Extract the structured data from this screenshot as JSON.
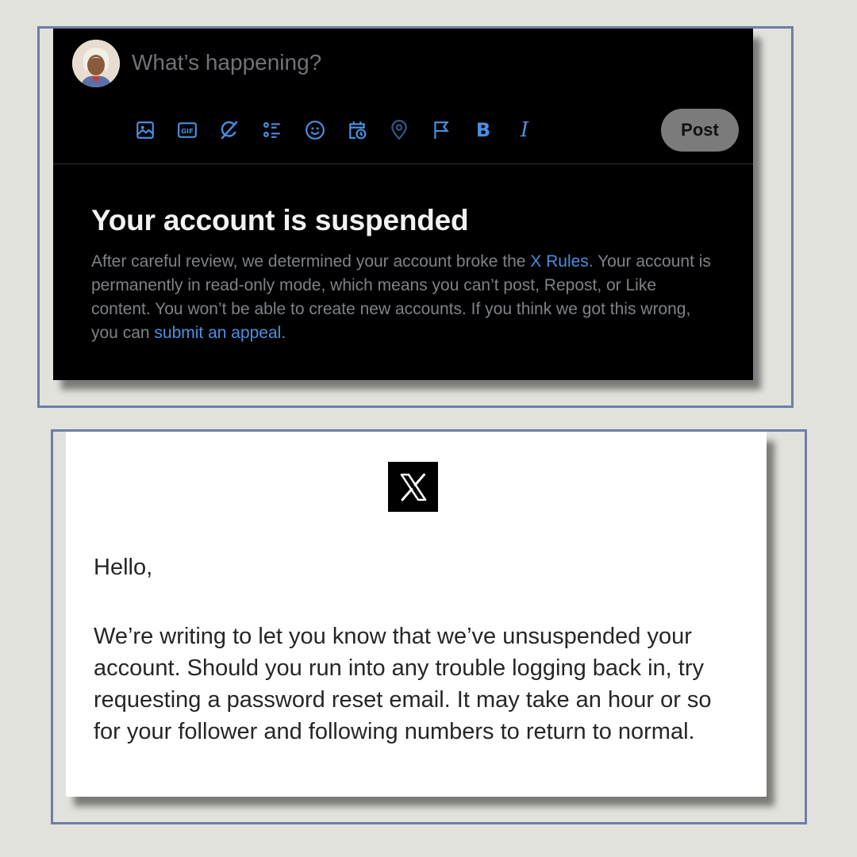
{
  "composer": {
    "placeholder": "What’s happening?",
    "toolbar": [
      {
        "icon": "image-icon"
      },
      {
        "icon": "gif-icon",
        "label": "GIF"
      },
      {
        "icon": "grok-icon"
      },
      {
        "icon": "poll-icon"
      },
      {
        "icon": "emoji-icon"
      },
      {
        "icon": "schedule-icon"
      },
      {
        "icon": "location-icon"
      },
      {
        "icon": "flag-icon"
      },
      {
        "icon": "bold-icon",
        "label": "B"
      },
      {
        "icon": "italic-icon",
        "label": "I"
      }
    ],
    "post_label": "Post"
  },
  "suspension": {
    "title": "Your account is suspended",
    "body_part1": "After careful review, we determined your account broke the ",
    "rules_link": "X Rules",
    "body_part2": ". Your account is permanently in read-only mode, which means you can’t post, Repost, or Like content. You won’t be able to create new accounts. If you think we got this wrong, you can ",
    "appeal_link": "submit an appeal",
    "body_part3": "."
  },
  "email": {
    "logo": "x-logo",
    "greeting": "Hello,",
    "body": "We’re writing to let you know that we’ve unsuspended your account. Should you run into any trouble logging back in, try requesting a password reset email. It may take an hour or so for your follower and following numbers to return to normal."
  },
  "colors": {
    "accent": "#4a90e2",
    "background": "#e1e2dc",
    "frame": "#6e7ea6"
  }
}
